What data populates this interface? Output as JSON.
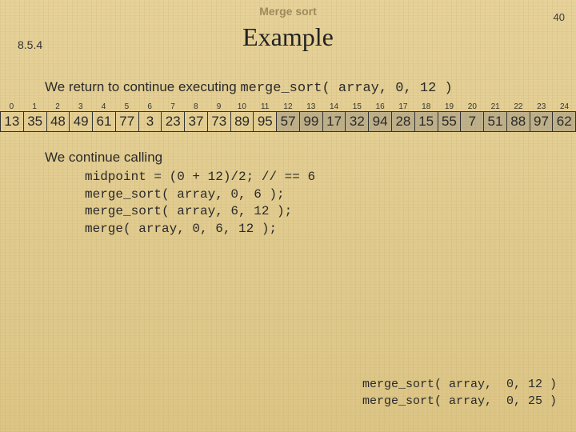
{
  "header": {
    "topbar": "Merge sort",
    "page_number": "40",
    "section": "8.5.4",
    "title": "Example"
  },
  "intro": {
    "prefix": "We return to continue executing ",
    "code": "merge_sort( array, 0, 12 )"
  },
  "array": {
    "indices": [
      "0",
      "1",
      "2",
      "3",
      "4",
      "5",
      "6",
      "7",
      "8",
      "9",
      "10",
      "11",
      "12",
      "13",
      "14",
      "15",
      "16",
      "17",
      "18",
      "19",
      "20",
      "21",
      "22",
      "23",
      "24"
    ],
    "values": [
      "13",
      "35",
      "48",
      "49",
      "61",
      "77",
      "3",
      "23",
      "37",
      "73",
      "89",
      "95",
      "57",
      "99",
      "17",
      "32",
      "94",
      "28",
      "15",
      "55",
      "7",
      "51",
      "88",
      "97",
      "62"
    ],
    "active_end": 12
  },
  "continue": {
    "lead": "We continue calling",
    "lines": [
      "midpoint = (0 + 12)/2; // == 6",
      "merge_sort( array, 0, 6 );",
      "merge_sort( array, 6, 12 );",
      "merge( array, 0, 6, 12 );"
    ]
  },
  "callstack": [
    "merge_sort( array,  0, 12 )",
    "merge_sort( array,  0, 25 )"
  ]
}
